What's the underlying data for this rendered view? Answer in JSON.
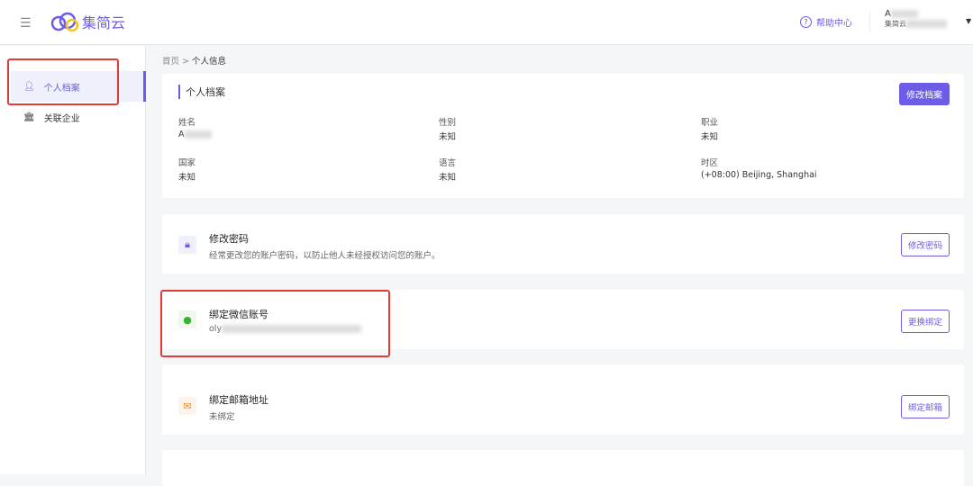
{
  "header": {
    "logo_text": "集简云",
    "help": "帮助中心",
    "user_name": "A",
    "user_org": "集简云"
  },
  "sidebar": {
    "items": [
      {
        "label": "个人档案"
      },
      {
        "label": "关联企业"
      }
    ]
  },
  "breadcrumb": {
    "home": "首页",
    "current": "个人信息"
  },
  "profile": {
    "title": "个人档案",
    "edit_button": "修改档案",
    "fields": [
      {
        "label": "姓名",
        "value": "A"
      },
      {
        "label": "性别",
        "value": "未知"
      },
      {
        "label": "职业",
        "value": "未知"
      },
      {
        "label": "国家",
        "value": "未知"
      },
      {
        "label": "语言",
        "value": "未知"
      },
      {
        "label": "时区",
        "value": "(+08:00) Beijing, Shanghai"
      }
    ]
  },
  "password": {
    "title": "修改密码",
    "desc": "经常更改您的账户密码，以防止他人未经授权访问您的账户。",
    "button": "修改密码"
  },
  "wechat": {
    "title": "绑定微信账号",
    "desc": "oly",
    "button": "更换绑定"
  },
  "email": {
    "title": "绑定邮箱地址",
    "desc": "未绑定",
    "button": "绑定邮箱"
  }
}
